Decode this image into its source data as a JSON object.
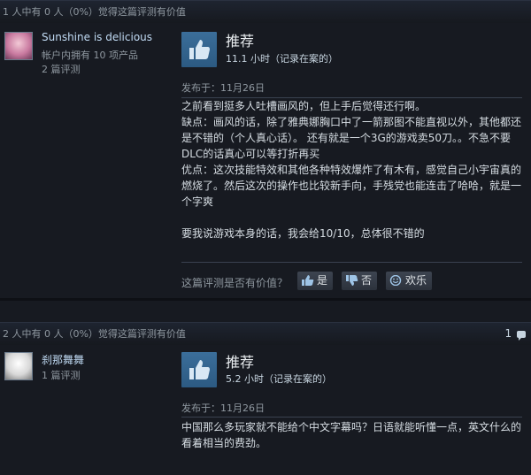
{
  "reviews": [
    {
      "helpful_text": "1 人中有 0 人（0%）觉得这篇评测有价值",
      "author_name": "Sunshine is delicious",
      "author_line1": "帐户内拥有 10 项产品",
      "author_line2": "2 篇评测",
      "verdict": "推荐",
      "hours": "11.1 小时（记录在案的）",
      "posted": "发布于：11月26日",
      "body": "之前看到挺多人吐槽画风的，但上手后觉得还行啊。\n缺点：画风的话，除了雅典娜胸口中了一箭那图不能直视以外，其他都还是不错的（个人真心话）。 还有就是一个3G的游戏卖50刀。。不急不要DLC的话真心可以等打折再买\n优点：这次技能特效和其他各种特效爆炸了有木有，感觉自己小宇宙真的燃烧了。然后这次的操作也比较新手向，手残党也能连击了哈哈，就是一个字爽\n\n要我说游戏本身的话，我会给10/10，总体很不错的",
      "question": "这篇评测是否有价值？",
      "btn_yes": "是",
      "btn_no": "否",
      "btn_funny": "欢乐"
    },
    {
      "helpful_text": "2 人中有 0 人（0%）觉得这篇评测有价值",
      "comment_count": "1",
      "author_name": "刹那舞舞",
      "author_line1": "1 篇评测",
      "verdict": "推荐",
      "hours": "5.2 小时（记录在案的）",
      "posted": "发布于：11月26日",
      "body": "中国那么多玩家就不能给个中文字幕吗？日语就能听懂一点，英文什么的看着相当的费劲。"
    }
  ],
  "icons": {
    "thumbs_up": "thumbs-up-icon",
    "thumbs_down": "thumbs-down-icon",
    "smile": "smile-icon",
    "comment": "comment-icon"
  },
  "colors": {
    "background": "#171a21",
    "vote_box": "#2c5a82",
    "author_name": "#c1dbf4",
    "muted": "#8f98a0"
  }
}
